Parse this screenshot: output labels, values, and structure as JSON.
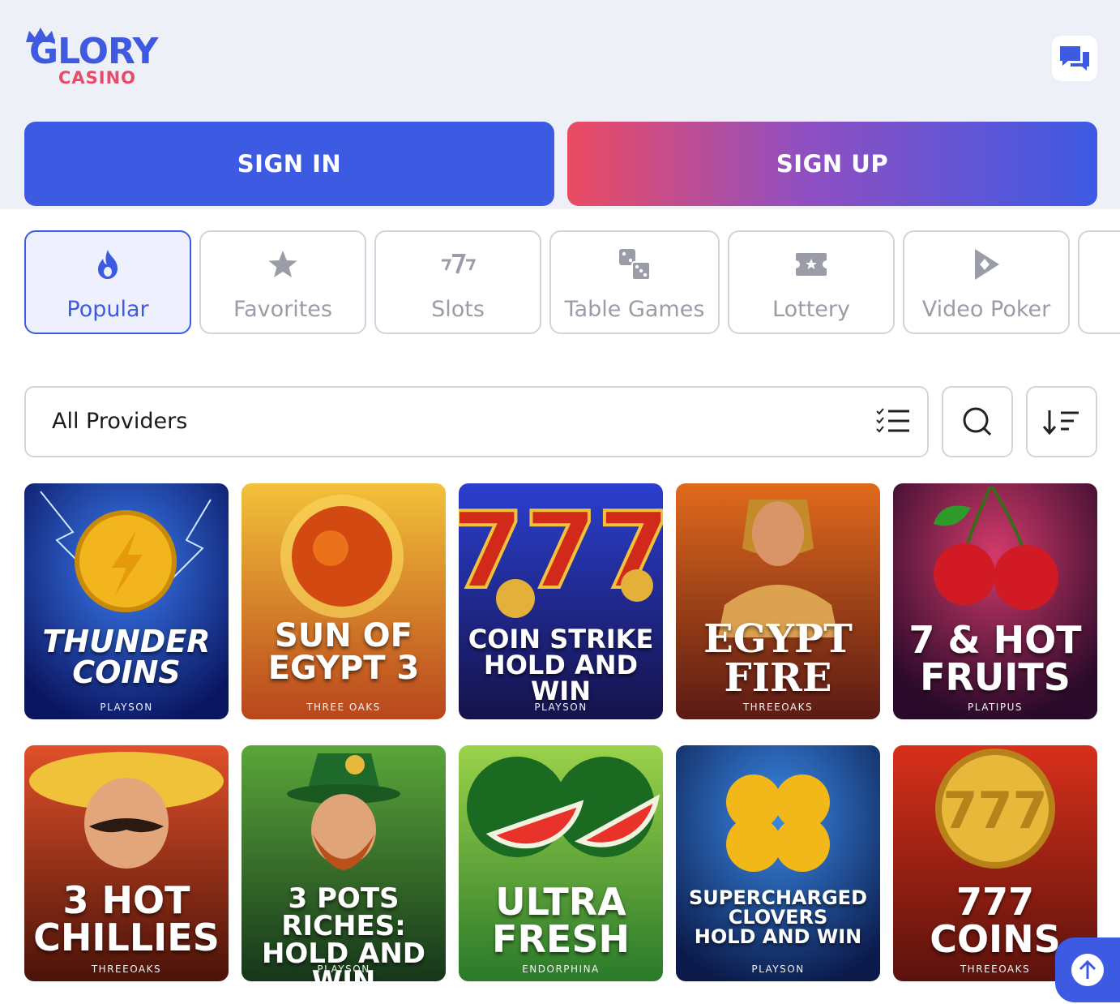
{
  "brand": {
    "name": "GLORY",
    "sub": "CASINO",
    "primary": "#3d5ae3",
    "accent": "#ea4a6a"
  },
  "header": {
    "chat_icon": "chat-bubbles-icon"
  },
  "auth": {
    "signin_label": "SIGN IN",
    "signup_label": "SIGN UP"
  },
  "categories": [
    {
      "label": "Popular",
      "icon": "flame-icon",
      "active": true
    },
    {
      "label": "Favorites",
      "icon": "star-icon"
    },
    {
      "label": "Slots",
      "icon": "seven-seven-seven-icon"
    },
    {
      "label": "Table Games",
      "icon": "dice-icon"
    },
    {
      "label": "Lottery",
      "icon": "ticket-icon"
    },
    {
      "label": "Video Poker",
      "icon": "poker-play-icon"
    }
  ],
  "filter": {
    "providers_label": "All Providers",
    "search_icon": "search-icon",
    "sort_icon": "sort-icon",
    "list_icon": "checklist-icon"
  },
  "games": [
    {
      "title": "THUNDER\nCOINS",
      "provider": "PLAYSON"
    },
    {
      "title": "SUN OF\nEGYPT 3",
      "provider": "THREE OAKS"
    },
    {
      "title": "COIN STRIKE\nHOLD AND WIN",
      "provider": "PLAYSON"
    },
    {
      "title": "EGYPT\nFIRE",
      "provider": "THREEOAKS"
    },
    {
      "title": "7 & HOT\nFRUITS",
      "provider": "PLATIPUS"
    },
    {
      "title": "3 HOT\nCHILLIES",
      "provider": "THREEOAKS"
    },
    {
      "title": "3 POTS RICHES:\nHOLD AND WIN",
      "provider": "PLAYSON"
    },
    {
      "title": "ULTRA\nFRESH",
      "provider": "ENDORPHINA"
    },
    {
      "title": "SUPERCHARGED\nCLOVERS\nHOLD AND WIN",
      "provider": "PLAYSON"
    },
    {
      "title": "777\nCOINS",
      "provider": "THREEOAKS"
    }
  ],
  "scroll_top_icon": "arrow-up-icon"
}
